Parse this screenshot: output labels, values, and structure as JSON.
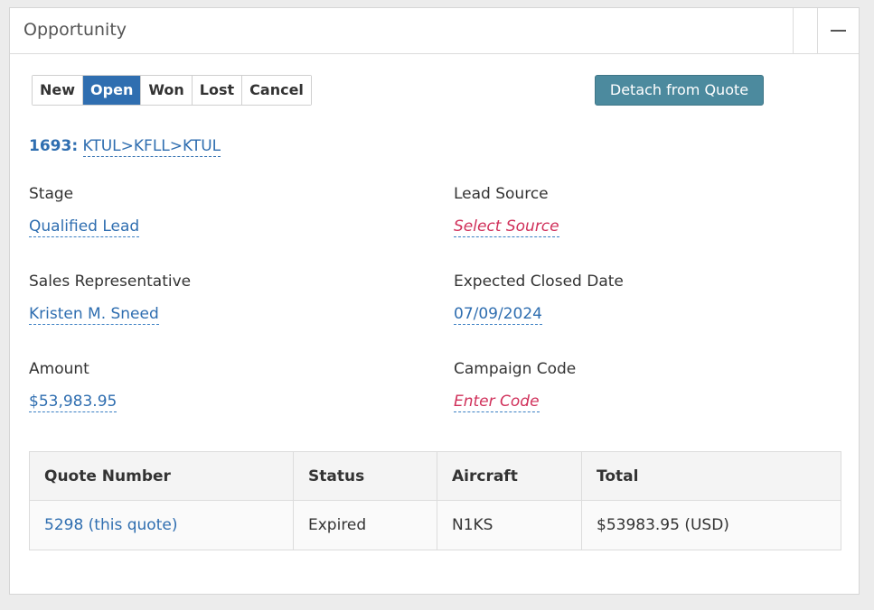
{
  "panel": {
    "title": "Opportunity"
  },
  "status_buttons": [
    {
      "label": "New",
      "active": false
    },
    {
      "label": "Open",
      "active": true
    },
    {
      "label": "Won",
      "active": false
    },
    {
      "label": "Lost",
      "active": false
    },
    {
      "label": "Cancel",
      "active": false
    }
  ],
  "detach_label": "Detach from Quote",
  "route": {
    "id": "1693:",
    "path": "KTUL>KFLL>KTUL"
  },
  "fields": {
    "stage": {
      "label": "Stage",
      "value": "Qualified Lead"
    },
    "lead_source": {
      "label": "Lead Source",
      "value": "Select Source"
    },
    "sales_rep": {
      "label": "Sales Representative",
      "value": "Kristen M. Sneed"
    },
    "closed_date": {
      "label": "Expected Closed Date",
      "value": "07/09/2024"
    },
    "amount": {
      "label": "Amount",
      "value": "$53,983.95"
    },
    "campaign": {
      "label": "Campaign Code",
      "value": "Enter Code"
    }
  },
  "table": {
    "columns": [
      "Quote Number",
      "Status",
      "Aircraft",
      "Total"
    ],
    "rows": [
      [
        "5298 (this quote)",
        "Expired",
        "N1KS",
        "$53983.95 (USD)"
      ]
    ]
  },
  "colors": {
    "accent": "#2f6eb0",
    "detach_button": "#4c8a9e",
    "placeholder_red": "#d0305a"
  }
}
